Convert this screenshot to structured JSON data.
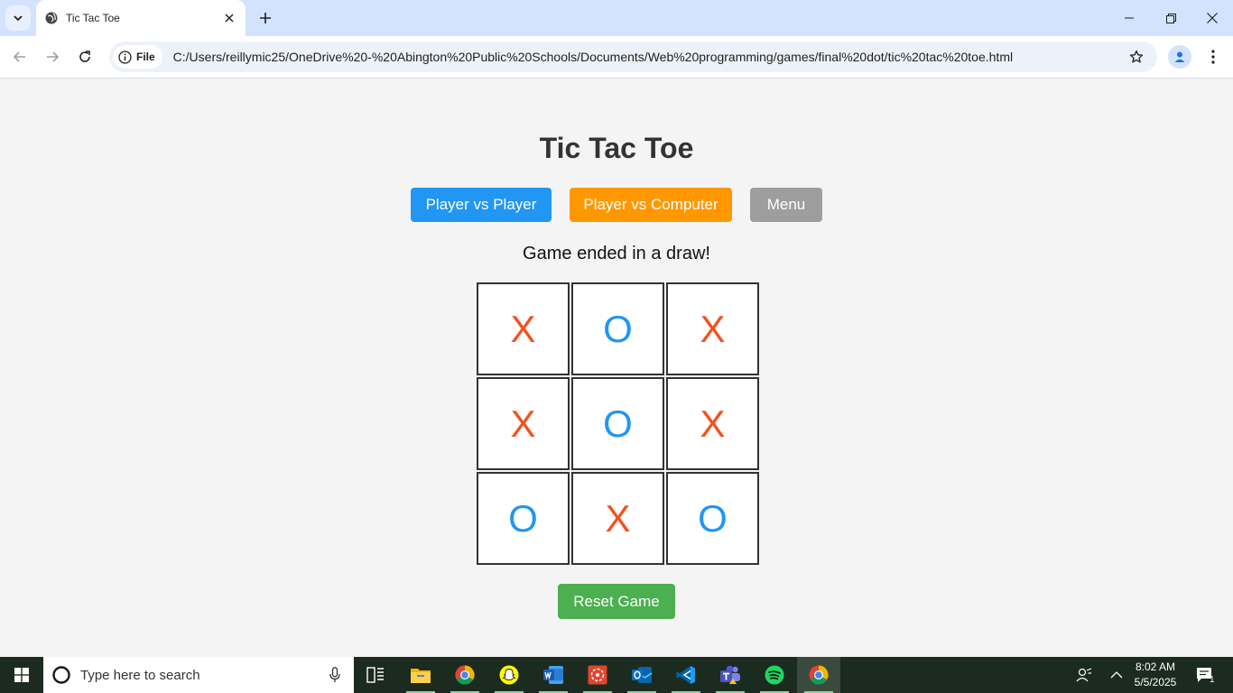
{
  "browser": {
    "tab_title": "Tic Tac Toe",
    "site_chip": "File",
    "url": "C:/Users/reillymic25/OneDrive%20-%20Abington%20Public%20Schools/Documents/Web%20programming/games/final%20dot/tic%20tac%20toe.html"
  },
  "game": {
    "title": "Tic Tac Toe",
    "buttons": {
      "pvp": "Player vs Player",
      "pvc": "Player vs Computer",
      "menu": "Menu",
      "reset": "Reset Game"
    },
    "status": "Game ended in a draw!",
    "board": [
      "X",
      "O",
      "X",
      "X",
      "O",
      "X",
      "O",
      "X",
      "O"
    ],
    "colors": {
      "x": "#f4511e",
      "o": "#2196f3",
      "pvp": "#2196f3",
      "pvc": "#ff9800",
      "menu": "#9e9e9e",
      "reset": "#4caf50"
    }
  },
  "taskbar": {
    "search_placeholder": "Type here to search",
    "apps": [
      "task-view-icon",
      "file-explorer-icon",
      "chrome-icon",
      "snapchat-icon",
      "word-icon",
      "app-icon",
      "outlook-icon",
      "vscode-icon",
      "teams-icon",
      "spotify-icon",
      "chrome-icon"
    ],
    "time": "8:02 AM",
    "date": "5/5/2025",
    "notification_count": "1"
  }
}
